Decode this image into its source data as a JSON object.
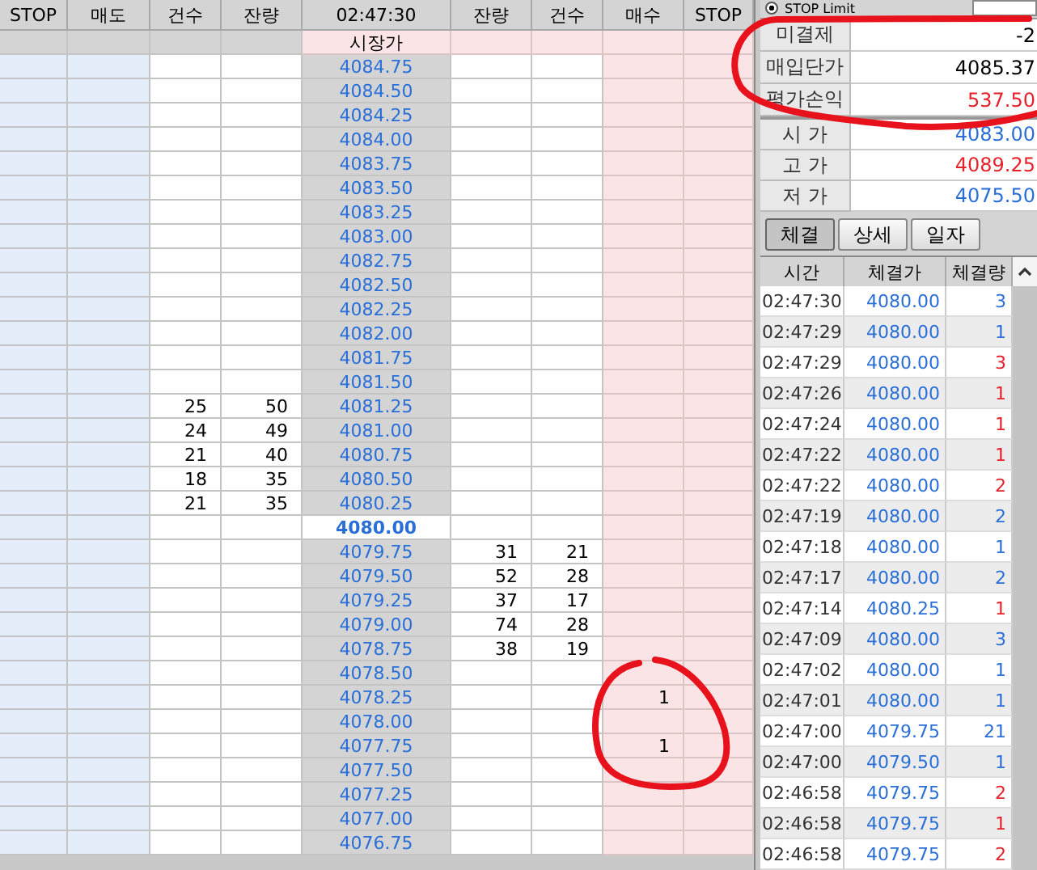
{
  "order_book": {
    "columns": [
      "STOP",
      "매도",
      "건수",
      "잔량",
      "02:47:30",
      "잔량",
      "건수",
      "매수",
      "STOP"
    ],
    "market_row": {
      "label": "시장가"
    },
    "rows": [
      {
        "price": "4084.75",
        "current": false
      },
      {
        "price": "4084.50",
        "current": false
      },
      {
        "price": "4084.25",
        "current": false
      },
      {
        "price": "4084.00",
        "current": false
      },
      {
        "price": "4083.75",
        "current": false
      },
      {
        "price": "4083.50",
        "current": false
      },
      {
        "price": "4083.25",
        "current": false
      },
      {
        "price": "4083.00",
        "current": false
      },
      {
        "price": "4082.75",
        "current": false
      },
      {
        "price": "4082.50",
        "current": false
      },
      {
        "price": "4082.25",
        "current": false
      },
      {
        "price": "4082.00",
        "current": false
      },
      {
        "price": "4081.75",
        "current": false
      },
      {
        "price": "4081.50",
        "current": false
      },
      {
        "price": "4081.25",
        "current": false,
        "ask_count": "25",
        "ask_qty": "50"
      },
      {
        "price": "4081.00",
        "current": false,
        "ask_count": "24",
        "ask_qty": "49"
      },
      {
        "price": "4080.75",
        "current": false,
        "ask_count": "21",
        "ask_qty": "40"
      },
      {
        "price": "4080.50",
        "current": false,
        "ask_count": "18",
        "ask_qty": "35"
      },
      {
        "price": "4080.25",
        "current": false,
        "ask_count": "21",
        "ask_qty": "35"
      },
      {
        "price": "4080.00",
        "current": true
      },
      {
        "price": "4079.75",
        "current": false,
        "bid_qty": "31",
        "bid_count": "21"
      },
      {
        "price": "4079.50",
        "current": false,
        "bid_qty": "52",
        "bid_count": "28"
      },
      {
        "price": "4079.25",
        "current": false,
        "bid_qty": "37",
        "bid_count": "17"
      },
      {
        "price": "4079.00",
        "current": false,
        "bid_qty": "74",
        "bid_count": "28"
      },
      {
        "price": "4078.75",
        "current": false,
        "bid_qty": "38",
        "bid_count": "19"
      },
      {
        "price": "4078.50",
        "current": false
      },
      {
        "price": "4078.25",
        "current": false,
        "buy_order": "1"
      },
      {
        "price": "4078.00",
        "current": false
      },
      {
        "price": "4077.75",
        "current": false,
        "buy_order": "1"
      },
      {
        "price": "4077.50",
        "current": false
      },
      {
        "price": "4077.25",
        "current": false
      },
      {
        "price": "4077.00",
        "current": false
      },
      {
        "price": "4076.75",
        "current": false
      }
    ]
  },
  "order_type": {
    "label": "STOP Limit",
    "selected": true
  },
  "position": [
    {
      "label": "미결제",
      "value": "-2",
      "color": "#000000"
    },
    {
      "label": "매입단가",
      "value": "4085.37",
      "color": "#000000"
    },
    {
      "label": "평가손익",
      "value": "537.50",
      "color": "#e8202a"
    }
  ],
  "prices": [
    {
      "label": "시 가",
      "value": "4083.00",
      "color": "#2a6fd8"
    },
    {
      "label": "고 가",
      "value": "4089.25",
      "color": "#e8202a"
    },
    {
      "label": "저 가",
      "value": "4075.50",
      "color": "#2a6fd8"
    }
  ],
  "tabs": [
    {
      "label": "체결",
      "selected": true
    },
    {
      "label": "상세",
      "selected": false
    },
    {
      "label": "일자",
      "selected": false
    }
  ],
  "trades": {
    "columns": [
      "시간",
      "체결가",
      "체결량"
    ],
    "rows": [
      {
        "time": "02:47:30",
        "price": "4080.00",
        "qty": "3",
        "color": "#2a6fd8"
      },
      {
        "time": "02:47:29",
        "price": "4080.00",
        "qty": "1",
        "color": "#2a6fd8"
      },
      {
        "time": "02:47:29",
        "price": "4080.00",
        "qty": "3",
        "color": "#e8202a"
      },
      {
        "time": "02:47:26",
        "price": "4080.00",
        "qty": "1",
        "color": "#e8202a"
      },
      {
        "time": "02:47:24",
        "price": "4080.00",
        "qty": "1",
        "color": "#e8202a"
      },
      {
        "time": "02:47:22",
        "price": "4080.00",
        "qty": "1",
        "color": "#e8202a"
      },
      {
        "time": "02:47:22",
        "price": "4080.00",
        "qty": "2",
        "color": "#e8202a"
      },
      {
        "time": "02:47:19",
        "price": "4080.00",
        "qty": "2",
        "color": "#2a6fd8"
      },
      {
        "time": "02:47:18",
        "price": "4080.00",
        "qty": "1",
        "color": "#2a6fd8"
      },
      {
        "time": "02:47:17",
        "price": "4080.00",
        "qty": "2",
        "color": "#2a6fd8"
      },
      {
        "time": "02:47:14",
        "price": "4080.25",
        "qty": "1",
        "color": "#e8202a"
      },
      {
        "time": "02:47:09",
        "price": "4080.00",
        "qty": "3",
        "color": "#2a6fd8"
      },
      {
        "time": "02:47:02",
        "price": "4080.00",
        "qty": "1",
        "color": "#2a6fd8"
      },
      {
        "time": "02:47:01",
        "price": "4080.00",
        "qty": "1",
        "color": "#2a6fd8"
      },
      {
        "time": "02:47:00",
        "price": "4079.75",
        "qty": "21",
        "color": "#2a6fd8"
      },
      {
        "time": "02:47:00",
        "price": "4079.50",
        "qty": "1",
        "color": "#2a6fd8"
      },
      {
        "time": "02:46:58",
        "price": "4079.75",
        "qty": "2",
        "color": "#e8202a"
      },
      {
        "time": "02:46:58",
        "price": "4079.75",
        "qty": "1",
        "color": "#e8202a"
      },
      {
        "time": "02:46:58",
        "price": "4079.75",
        "qty": "2",
        "color": "#e8202a"
      }
    ]
  },
  "annotations": [
    {
      "kind": "circle",
      "color": "#e8121c"
    },
    {
      "kind": "circle",
      "color": "#e8121c"
    }
  ]
}
